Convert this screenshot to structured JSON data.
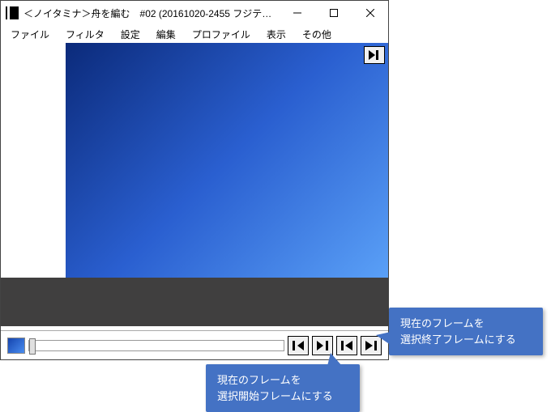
{
  "window": {
    "title": "＜ノイタミナ＞舟を編む　#02 (20161020-2455 フジテレビジョ..."
  },
  "menu": {
    "file": "ファイル",
    "filter": "フィルタ",
    "settings": "設定",
    "edit": "編集",
    "profile": "プロファイル",
    "display": "表示",
    "other": "その他"
  },
  "callouts": {
    "end": {
      "line1": "現在のフレームを",
      "line2": "選択終了フレームにする"
    },
    "start": {
      "line1": "現在のフレームを",
      "line2": "選択開始フレームにする"
    }
  }
}
